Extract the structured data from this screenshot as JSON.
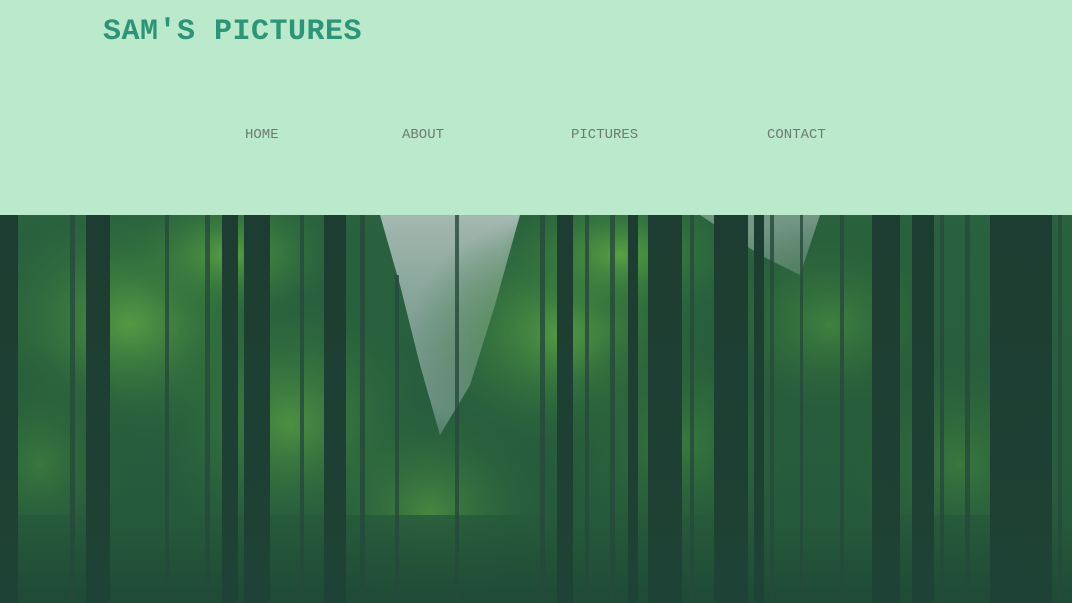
{
  "header": {
    "site_title": "SAM'S PICTURES",
    "background_color": "#bbe9cb",
    "title_color": "#2e9478"
  },
  "nav": {
    "items": [
      {
        "label": "HOME"
      },
      {
        "label": "ABOUT"
      },
      {
        "label": "PICTURES"
      },
      {
        "label": "CONTACT"
      }
    ]
  },
  "hero": {
    "image_subject": "forest-trees",
    "overlay_color": "#1f4a3a"
  }
}
